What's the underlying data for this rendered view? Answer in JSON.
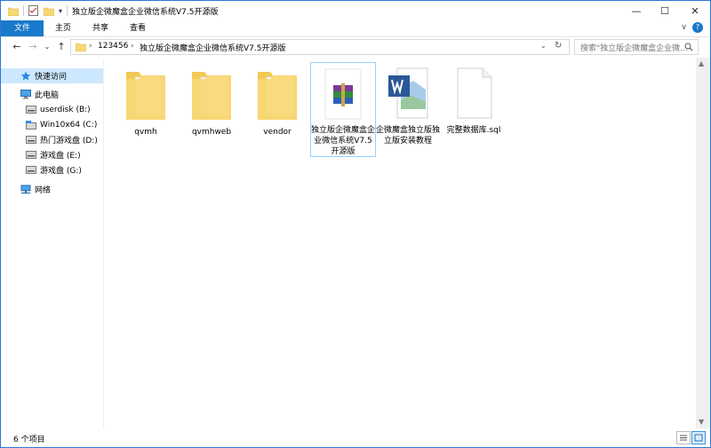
{
  "window": {
    "title": "独立版企微魔盒企业微信系统V7.5开源版",
    "minimize_glyph": "—",
    "maximize_glyph": "☐",
    "close_glyph": "✕"
  },
  "ribbon": {
    "tabs": [
      {
        "label": "文件"
      },
      {
        "label": "主页"
      },
      {
        "label": "共享"
      },
      {
        "label": "查看"
      }
    ],
    "expand_glyph": "∨",
    "help_glyph": "?"
  },
  "nav": {
    "back_glyph": "←",
    "forward_glyph": "→",
    "history_glyph": "⌄",
    "up_glyph": "↑",
    "refresh_glyph": "↻",
    "breadcrumb": [
      "123456",
      "独立版企微魔盒企业微信系统V7.5开源版"
    ],
    "separator": "›"
  },
  "search": {
    "placeholder": "搜索\"独立版企微魔盒企业微..."
  },
  "sidebar": {
    "items": [
      {
        "label": "快速访问",
        "icon": "star-icon"
      },
      {
        "label": "此电脑",
        "icon": "computer-icon"
      },
      {
        "label": "userdisk (B:)",
        "icon": "drive-icon"
      },
      {
        "label": "Win10x64 (C:)",
        "icon": "system-drive-icon"
      },
      {
        "label": "热门游戏盘 (D:)",
        "icon": "drive-icon"
      },
      {
        "label": "游戏盘 (E:)",
        "icon": "drive-icon"
      },
      {
        "label": "游戏盘 (G:)",
        "icon": "drive-icon"
      },
      {
        "label": "网络",
        "icon": "network-icon"
      }
    ]
  },
  "files": [
    {
      "name": "qvmh",
      "type": "folder"
    },
    {
      "name": "qvmhweb",
      "type": "folder"
    },
    {
      "name": "vendor",
      "type": "folder"
    },
    {
      "name": "独立版企微魔盒企业微信系统V7.5开源版",
      "type": "rar"
    },
    {
      "name": "企微魔盒独立版独立版安装教程",
      "type": "word"
    },
    {
      "name": "完整数据库.sql",
      "type": "file"
    }
  ],
  "status": {
    "count_text": "6 个项目"
  },
  "colors": {
    "accent": "#1979ca",
    "folder": "#f8d775",
    "selection": "#cce8ff"
  }
}
